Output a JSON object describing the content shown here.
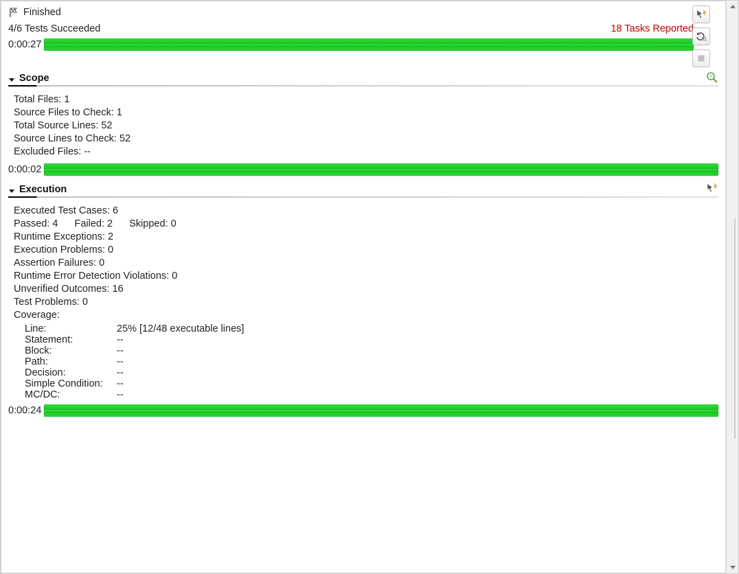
{
  "status": {
    "title": "Finished",
    "summary": "4/6 Tests Succeeded",
    "tasks_reported": "18 Tasks Reported",
    "elapsed": "0:00:27"
  },
  "scope": {
    "heading": "Scope",
    "total_files": "Total Files: 1",
    "source_files_to_check": "Source Files to Check: 1",
    "total_source_lines": "Total Source Lines: 52",
    "source_lines_to_check": "Source Lines to Check: 52",
    "excluded_files": "Excluded Files: --",
    "elapsed": "0:00:02"
  },
  "execution": {
    "heading": "Execution",
    "executed": "Executed Test Cases: 6",
    "passed": "Passed:  4",
    "failed": "Failed: 2",
    "skipped": "Skipped: 0",
    "runtime_exceptions": "Runtime Exceptions: 2",
    "execution_problems": "Execution Problems: 0",
    "assertion_failures": "Assertion Failures: 0",
    "runtime_error_detection": "Runtime Error Detection Violations: 0",
    "unverified_outcomes": "Unverified Outcomes: 16",
    "test_problems": "Test Problems: 0",
    "coverage_heading": "Coverage:",
    "coverage": {
      "line_label": "Line:",
      "line_val": "25% [12/48 executable lines]",
      "statement_label": "Statement:",
      "statement_val": "--",
      "block_label": "Block:",
      "block_val": "--",
      "path_label": "Path:",
      "path_val": "--",
      "decision_label": "Decision:",
      "decision_val": "--",
      "simple_cond_label": "Simple Condition:",
      "simple_cond_val": "--",
      "mcdc_label": "MC/DC:",
      "mcdc_val": "--"
    },
    "elapsed": "0:00:24"
  }
}
